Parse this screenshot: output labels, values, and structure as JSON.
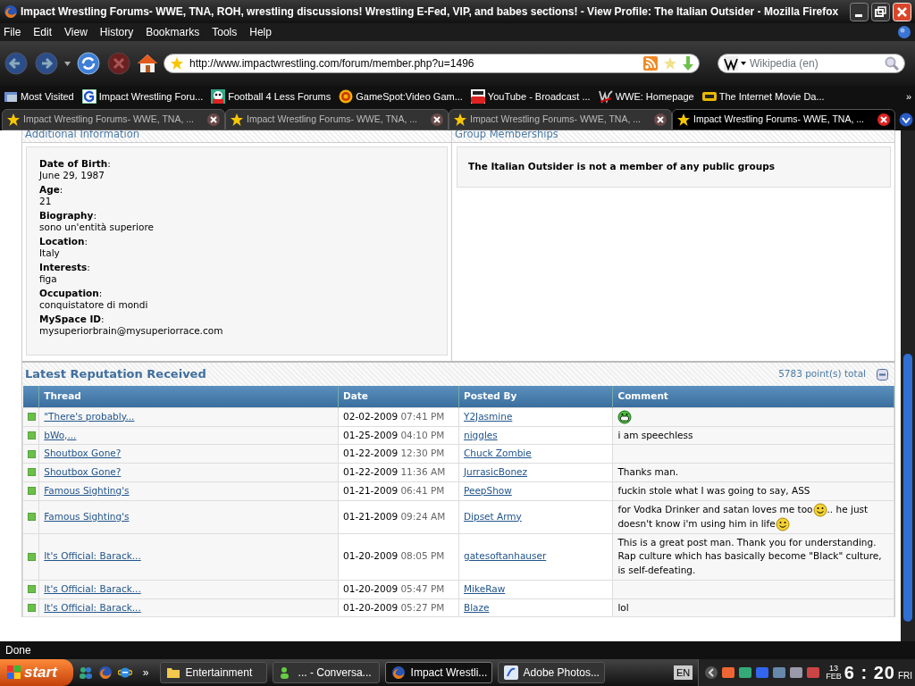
{
  "window": {
    "title": "Impact Wrestling Forums- WWE, TNA, ROH, wrestling discussions! Wrestling E-Fed, VIP, and babes sections! - View Profile: The Italian Outsider - Mozilla Firefox"
  },
  "menu": [
    "File",
    "Edit",
    "View",
    "History",
    "Bookmarks",
    "Tools",
    "Help"
  ],
  "address_bar": {
    "url": "http://www.impactwrestling.com/forum/member.php?u=1496"
  },
  "search": {
    "placeholder": "Wikipedia (en)"
  },
  "bookmarks": [
    {
      "label": "Most Visited",
      "kind": "folder"
    },
    {
      "label": "Impact Wrestling Foru...",
      "kind": "g"
    },
    {
      "label": "Football 4 Less Forums",
      "kind": "ball"
    },
    {
      "label": "GameSpot:Video Gam...",
      "kind": "gs"
    },
    {
      "label": "YouTube - Broadcast ...",
      "kind": "yt"
    },
    {
      "label": "WWE: Homepage",
      "kind": "wwe"
    },
    {
      "label": "The Internet Movie Da...",
      "kind": "imdb"
    }
  ],
  "bookmarks_more": "»",
  "tabs": [
    {
      "label": "Impact Wrestling Forums- WWE, TNA, ...",
      "selected": false
    },
    {
      "label": "Impact Wrestling Forums- WWE, TNA, ...",
      "selected": false
    },
    {
      "label": "Impact Wrestling Forums- WWE, TNA, ...",
      "selected": false
    },
    {
      "label": "Impact Wrestling Forums- WWE, TNA, ...",
      "selected": true
    }
  ],
  "additional_info": {
    "heading": "Additional Information",
    "fields": [
      {
        "label": "**Date of Birth**:",
        "value": "June 29, 1987"
      },
      {
        "label": "**Age**:",
        "value": "21"
      },
      {
        "label": "**Biography**:",
        "value": "sono un'entità superiore"
      },
      {
        "label": "**Location**:",
        "value": "Italy"
      },
      {
        "label": "**Interests**:",
        "value": "figa"
      },
      {
        "label": "**Occupation**:",
        "value": "conquistatore di mondi"
      },
      {
        "label": "**MySpace ID**:",
        "value": "mysuperiorbrain@mysuperiorrace.com"
      }
    ]
  },
  "group_memberships": {
    "heading": "Group Memberships",
    "message": "The Italian Outsider is not a member of any public groups"
  },
  "reputation": {
    "heading": "Latest Reputation Received",
    "total": "5783 point(s) total",
    "columns": [
      "Thread",
      "Date",
      "Posted By",
      "Comment"
    ],
    "rows": [
      {
        "thread": "\"There's probably...",
        "date": "02-02-2009",
        "time": "07:41 PM",
        "posted_by": "Y2Jasmine",
        "comment": [
          {
            "kind": "grin"
          }
        ]
      },
      {
        "thread": "bWo,...",
        "date": "01-25-2009",
        "time": "04:10 PM",
        "posted_by": "niggles",
        "comment": [
          {
            "kind": "text",
            "text": "i am speechless"
          }
        ]
      },
      {
        "thread": "Shoutbox Gone?",
        "date": "01-22-2009",
        "time": "12:30 PM",
        "posted_by": "Chuck Zombie",
        "comment": []
      },
      {
        "thread": "Shoutbox Gone?",
        "date": "01-22-2009",
        "time": "11:36 AM",
        "posted_by": "JurrasicBonez",
        "comment": [
          {
            "kind": "text",
            "text": "Thanks man."
          }
        ]
      },
      {
        "thread": "Famous Sighting's",
        "date": "01-21-2009",
        "time": "06:41 PM",
        "posted_by": "PeepShow",
        "comment": [
          {
            "kind": "text",
            "text": "fuckin stole what I was going to say, ASS"
          }
        ]
      },
      {
        "thread": "Famous Sighting's",
        "date": "01-21-2009",
        "time": "09:24 AM",
        "posted_by": "Dipset Army",
        "comment": [
          {
            "kind": "text",
            "text": "for Vodka Drinker and satan loves me too"
          },
          {
            "kind": "smile"
          },
          {
            "kind": "text",
            "text": ".. he just doesn't know i'm using him in life"
          },
          {
            "kind": "smile"
          }
        ]
      },
      {
        "thread": "It's Official: Barack...",
        "date": "01-20-2009",
        "time": "08:05 PM",
        "posted_by": "gatesoftanhauser",
        "comment": [
          {
            "kind": "text",
            "text": "This is a great post man. Thank you for understanding. Rap culture which has basically become \"Black\" culture, is self-defeating."
          }
        ]
      },
      {
        "thread": "It's Official: Barack...",
        "date": "01-20-2009",
        "time": "05:47 PM",
        "posted_by": "MikeRaw",
        "comment": []
      },
      {
        "thread": "It's Official: Barack...",
        "date": "01-20-2009",
        "time": "05:27 PM",
        "posted_by": "Blaze",
        "comment": [
          {
            "kind": "text",
            "text": "lol"
          }
        ]
      }
    ]
  },
  "status_bar": "Done",
  "taskbar": {
    "start": "start",
    "more": "»",
    "tasks": [
      {
        "label": "Entertainment",
        "kind": "folder",
        "selected": false
      },
      {
        "label": "... - Conversa...",
        "kind": "messenger",
        "selected": false
      },
      {
        "label": "Impact Wrestli...",
        "kind": "firefox",
        "selected": true
      },
      {
        "label": "Adobe Photos...",
        "kind": "photoshop",
        "selected": false
      }
    ],
    "language": "EN",
    "day": "13",
    "month": "FEB",
    "time": "6 : 20",
    "weekday": "FRI"
  }
}
